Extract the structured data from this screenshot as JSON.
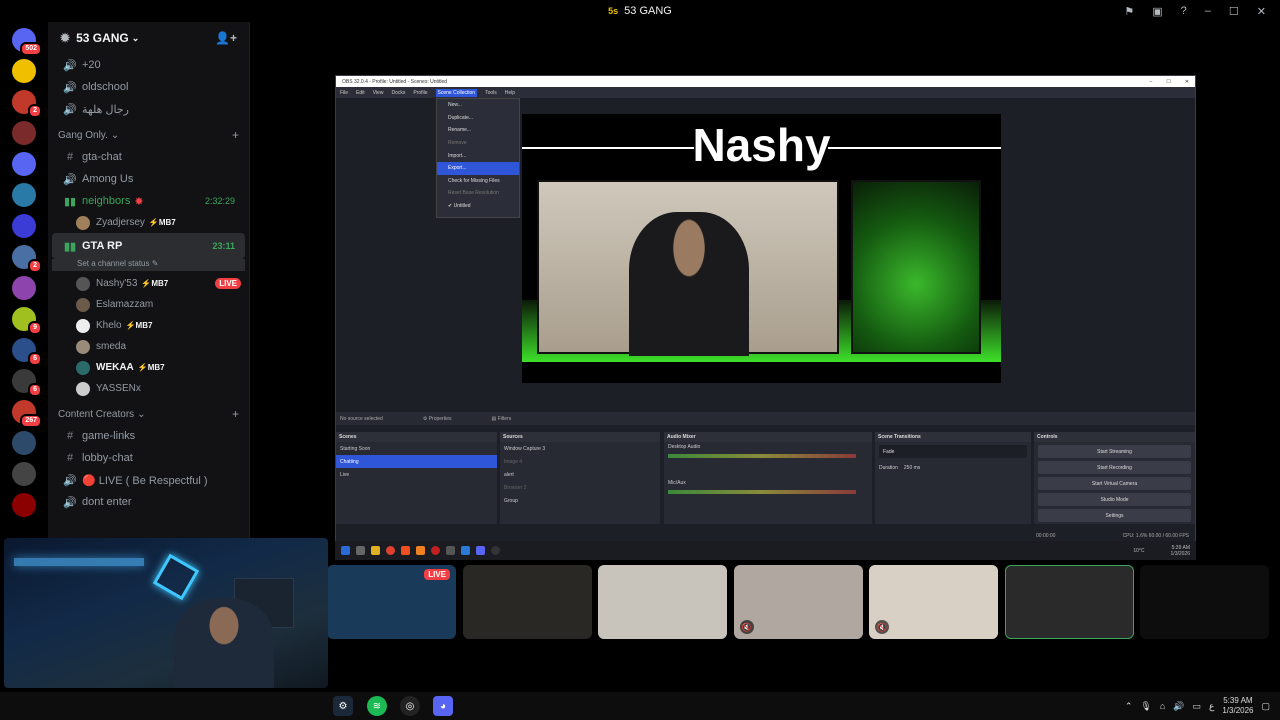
{
  "window": {
    "title": "53 GANG",
    "title_icon": "5s"
  },
  "titlebar_icons": [
    "inbox-icon",
    "screen-icon",
    "help-icon",
    "minimize-icon",
    "maximize-icon",
    "close-icon"
  ],
  "server_list": [
    {
      "name": "dm-home",
      "badge": "502",
      "color": "#5865f2"
    },
    {
      "name": "53-gang",
      "badge": "",
      "color": "#f0c000"
    },
    {
      "name": "server-2",
      "badge": "2",
      "color": "#c0392b"
    },
    {
      "name": "server-3",
      "badge": "",
      "color": "#7a2a2a"
    },
    {
      "name": "server-4",
      "badge": "",
      "color": "#5865f2"
    },
    {
      "name": "server-5",
      "badge": "",
      "color": "#2a7aa8"
    },
    {
      "name": "server-6",
      "badge": "",
      "color": "#3b3bd6"
    },
    {
      "name": "server-7",
      "badge": "2",
      "color": "#4a6fa5"
    },
    {
      "name": "server-8",
      "badge": "",
      "color": "#8e44ad"
    },
    {
      "name": "server-9",
      "badge": "9",
      "color": "#a0c020"
    },
    {
      "name": "server-10",
      "badge": "6",
      "color": "#2a4f8a"
    },
    {
      "name": "server-11",
      "badge": "6",
      "color": "#3a3a3a"
    },
    {
      "name": "server-12",
      "badge": "267",
      "color": "#c0392b"
    },
    {
      "name": "server-13",
      "badge": "",
      "color": "#2e4a6a"
    },
    {
      "name": "server-14",
      "badge": "",
      "color": "#444"
    },
    {
      "name": "server-15",
      "badge": "",
      "color": "#8b0000"
    }
  ],
  "sidebar": {
    "server_name": "53 GANG",
    "top_channels": [
      {
        "icon": "🔊",
        "label": "+20"
      },
      {
        "icon": "🔊",
        "label": "oldschool"
      },
      {
        "icon": "🔊",
        "label": "رجال هلهة"
      }
    ],
    "category_gang": "Gang Only.",
    "gang_channels": [
      {
        "icon": "#",
        "label": "gta-chat"
      },
      {
        "icon": "🔊",
        "label": "Among Us"
      }
    ],
    "neighbors": {
      "label": "neighbors",
      "time": "2:32:29"
    },
    "neighbors_users": [
      {
        "name": "Zyadjersey",
        "tag": "⚡MB7",
        "avatar": "#a0805a"
      }
    ],
    "gta_rp": {
      "label": "GTA RP",
      "time": "23:11",
      "status": "Set a channel status"
    },
    "gta_users": [
      {
        "name": "Nashy'53",
        "tag": "⚡MB7",
        "avatar": "#555",
        "live": "LIVE",
        "bold": false
      },
      {
        "name": "Eslamazzam",
        "tag": "",
        "avatar": "#6b5a4a",
        "live": "",
        "bold": false
      },
      {
        "name": "Khelo",
        "tag": "⚡MB7",
        "avatar": "#eee",
        "live": "",
        "bold": false
      },
      {
        "name": "smeda",
        "tag": "",
        "avatar": "#9a8a7a",
        "live": "",
        "bold": false
      },
      {
        "name": "WEKAA",
        "tag": "⚡MB7",
        "avatar": "#2a6a6a",
        "live": "",
        "bold": true
      },
      {
        "name": "YASSENx",
        "tag": "",
        "avatar": "#ccc",
        "live": "",
        "bold": false
      }
    ],
    "category_creators": "Content Creators",
    "creator_channels": [
      {
        "icon": "#",
        "label": "game-links"
      },
      {
        "icon": "#",
        "label": "lobby-chat"
      },
      {
        "icon": "🔊",
        "label": "🔴 LIVE ( Be Respectful )"
      },
      {
        "icon": "🔊",
        "label": "dont enter"
      }
    ]
  },
  "obs": {
    "title": "OBS 32.0.4 - Profile: Untitled - Scenes: Untitled",
    "menu": [
      "File",
      "Edit",
      "View",
      "Docks",
      "Profile",
      "Scene Collection",
      "Tools",
      "Help"
    ],
    "menu_selected": "Scene Collection",
    "dropdown": [
      {
        "label": "New...",
        "state": ""
      },
      {
        "label": "Duplicate...",
        "state": ""
      },
      {
        "label": "Rename...",
        "state": ""
      },
      {
        "label": "Remove",
        "state": "dis"
      },
      {
        "label": "Import...",
        "state": ""
      },
      {
        "label": "Export...",
        "state": "hl"
      },
      {
        "label": "Check for Missing Files",
        "state": ""
      },
      {
        "label": "Reset Base Resolution",
        "state": "dis"
      },
      {
        "label": "✔ Untitled",
        "state": ""
      }
    ],
    "preview_title": "Nashy",
    "no_source": "No source selected",
    "props_label": "Properties",
    "filters_label": "Filters",
    "scenes_header": "Scenes",
    "scenes": [
      "Starting Soon",
      "Chatting",
      "Live"
    ],
    "scene_selected": "Chatting",
    "sources_header": "Sources",
    "sources": [
      {
        "label": "Window Capture 3",
        "dim": false
      },
      {
        "label": "Image 4",
        "dim": true
      },
      {
        "label": "alert",
        "dim": false
      },
      {
        "label": "Browser 2",
        "dim": true
      },
      {
        "label": "Group",
        "dim": false
      }
    ],
    "mixer_header": "Audio Mixer",
    "mixer": [
      {
        "label": "Desktop Audio",
        "db": "0.0 dB"
      },
      {
        "label": "Mic/Aux",
        "db": "0.0 dB"
      }
    ],
    "transitions_header": "Scene Transitions",
    "transition": "Fade",
    "duration_label": "Duration",
    "duration": "250 ms",
    "controls_header": "Controls",
    "controls": [
      "Start Streaming",
      "Start Recording",
      "Start Virtual Camera",
      "Studio Mode",
      "Settings"
    ],
    "status": "CPU: 1.6%   60.00 / 60.00 FPS",
    "timecode": "00:00:00"
  },
  "obs_taskbar": {
    "weather": "10°C",
    "clock_time": "5:39 AM",
    "clock_date": "1/3/2026"
  },
  "tiles": [
    {
      "name": "tile-nashy-stream",
      "live": "LIVE",
      "mic": "",
      "bg": "#1a3a5a"
    },
    {
      "name": "tile-user-2",
      "live": "",
      "mic": "",
      "bg": "#2a2824"
    },
    {
      "name": "tile-user-3",
      "live": "",
      "mic": "",
      "bg": "#c8c4bc"
    },
    {
      "name": "tile-user-4",
      "live": "",
      "mic": "🔇",
      "bg": "#b0a8a0"
    },
    {
      "name": "tile-user-5",
      "live": "",
      "mic": "🔇",
      "bg": "#d8d0c4"
    },
    {
      "name": "tile-user-6",
      "live": "",
      "mic": "",
      "bg": "#2a2a2a"
    },
    {
      "name": "tile-user-7",
      "live": "",
      "mic": "",
      "bg": "#0d0d0d"
    }
  ],
  "taskbar": {
    "apps": [
      "steam-icon",
      "spotify-icon",
      "obs-icon",
      "discord-icon"
    ],
    "clock_time": "5:39 AM",
    "clock_date": "1/3/2026",
    "lang": "ع"
  }
}
